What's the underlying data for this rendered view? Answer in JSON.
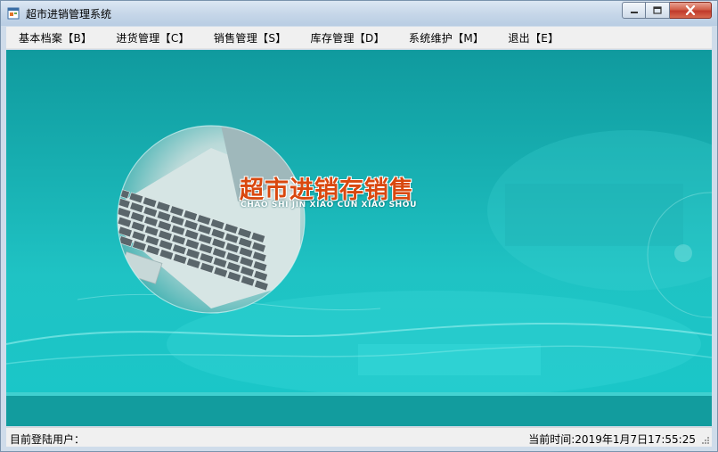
{
  "window": {
    "title": "超市进销管理系统"
  },
  "menu": {
    "items": [
      {
        "label": "基本档案【B】"
      },
      {
        "label": "进货管理【C】"
      },
      {
        "label": "销售管理【S】"
      },
      {
        "label": "库存管理【D】"
      },
      {
        "label": "系统维护【M】"
      },
      {
        "label": "退出【E】"
      }
    ]
  },
  "banner": {
    "title": "超市进销存销售",
    "subtitle": "CHAO SHI JIN XIAO CUN XIAO SHOU"
  },
  "status": {
    "user_label": "目前登陆用户：",
    "time_label": "当前时间:2019年1月7日17:55:25"
  },
  "colors": {
    "background": "#17aeb0",
    "logo_text": "#d9480f",
    "close_button": "#c0392b"
  },
  "icons": {
    "app": "app-window-icon",
    "minimize": "minimize-icon",
    "maximize": "maximize-icon",
    "close": "close-icon"
  }
}
